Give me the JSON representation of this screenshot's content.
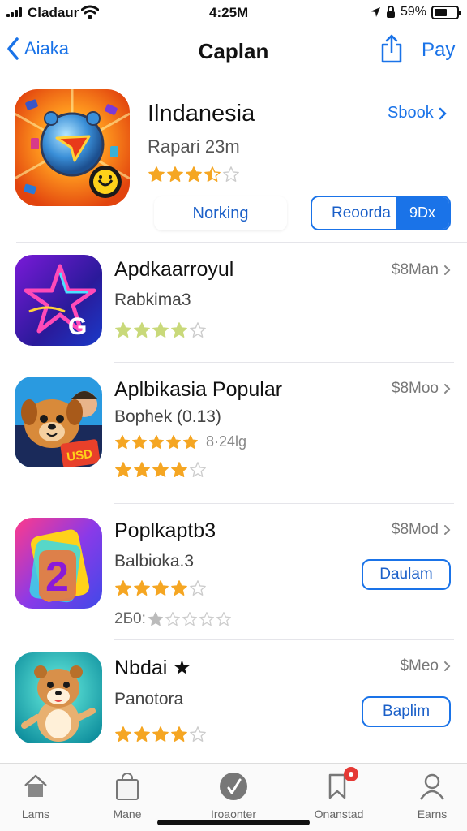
{
  "status_bar": {
    "carrier": "Cladaur",
    "time": "4:25M",
    "battery": "59%",
    "battery_level": 0.59,
    "icons": [
      "signal-icon",
      "wifi-icon",
      "location-arrow-icon",
      "lock-icon",
      "battery-icon"
    ]
  },
  "nav": {
    "back_label": "Aiaka",
    "title": "Caplan",
    "share_icon": "share-icon",
    "action_label": "Pay"
  },
  "featured": {
    "title": "Ilndanesia",
    "subtitle": "Rapari 23m",
    "rating": 3.5,
    "link_label": "Sbook",
    "button1_label": "Norking",
    "button2_label": "Reoorda",
    "button2_tag": "9Dx"
  },
  "apps": [
    {
      "title": "Apdkaarroyul",
      "subtitle": "Rabkima3",
      "rating": 4,
      "price": "$8Man",
      "star_color": "#c9d97a"
    },
    {
      "title": "Aplbikasia Popular",
      "subtitle": "Bophek (0.13)",
      "rating": 5,
      "rating_count": "8·24lg",
      "rating2": 4,
      "price": "$8Moo",
      "star_color": "#f5a623"
    },
    {
      "title": "Poplkaptb3",
      "subtitle": "Balbioka.3",
      "rating": 4,
      "extra_label": "2Б0:",
      "extra_rating": 1,
      "price": "$8Mod",
      "button_label": "Daulam",
      "star_color": "#f5a623"
    },
    {
      "title": "Nbdai ★",
      "subtitle": "Panotora",
      "rating": 4,
      "price": "$Meo",
      "button_label": "Baplim",
      "star_color": "#f5a623"
    }
  ],
  "tabbar": {
    "tabs": [
      {
        "label": "Lams",
        "icon": "home-icon"
      },
      {
        "label": "Mane",
        "icon": "bag-icon"
      },
      {
        "label": "Iroaonter",
        "icon": "play-icon"
      },
      {
        "label": "Onanstad",
        "icon": "bookmark-icon",
        "badge": true
      },
      {
        "label": "Earns",
        "icon": "person-icon"
      }
    ]
  },
  "colors": {
    "accent": "#1a73e8",
    "star": "#f5a623",
    "star_empty": "#cccccc"
  }
}
